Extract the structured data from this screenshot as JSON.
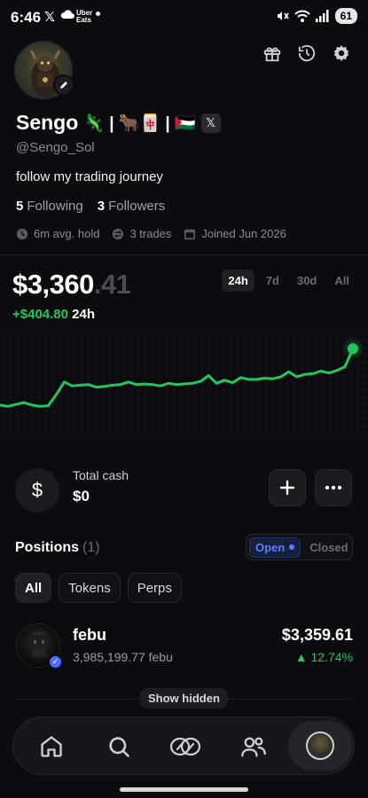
{
  "status_bar": {
    "time": "6:46",
    "x_glyph": "𝕏",
    "uber_line1": "Uber",
    "uber_line2": "Eats",
    "battery": "61",
    "icons": [
      "x-icon",
      "cloud-icon",
      "uber-eats-icon",
      "dot-icon",
      "mute-icon",
      "wifi-icon",
      "signal-icon",
      "battery-icon"
    ]
  },
  "header": {
    "icons": [
      "gift-icon",
      "history-icon",
      "settings-icon"
    ]
  },
  "profile": {
    "name": "Sengo",
    "name_emojis": "🦎 | 🐂🀄 | 🇵🇸",
    "x_badge": "𝕏",
    "handle": "@Sengo_Sol",
    "bio": "follow my trading journey",
    "following_count": "5",
    "following_label": "Following",
    "followers_count": "3",
    "followers_label": "Followers",
    "avg_hold": "6m avg. hold",
    "trades": "3 trades",
    "joined": "Joined Jun 2026"
  },
  "balance": {
    "dollars": "$3,360",
    "cents": ".41",
    "change_amount": "+$404.80",
    "change_period": "24h"
  },
  "range_tabs": [
    "24h",
    "7d",
    "30d",
    "All"
  ],
  "active_range": "24h",
  "chart_data": {
    "type": "line",
    "color": "#22c55e",
    "values": [
      3.2,
      3.0,
      3.3,
      3.6,
      3.2,
      3.0,
      3.1,
      4.8,
      6.8,
      6.2,
      6.3,
      6.4,
      6.0,
      6.1,
      6.3,
      6.4,
      6.8,
      6.4,
      6.5,
      6.4,
      6.2,
      6.6,
      6.4,
      6.5,
      6.6,
      6.9,
      7.8,
      6.6,
      7.1,
      6.7,
      7.5,
      7.2,
      7.2,
      7.4,
      7.3,
      7.6,
      8.4,
      7.6,
      8.0,
      8.1,
      8.5,
      8.2,
      8.6,
      9.2,
      12.0
    ],
    "ylim": [
      0,
      13
    ]
  },
  "cash": {
    "label": "Total cash",
    "value": "$0",
    "icon": "$",
    "add_icon": "+",
    "more_icon": "⋯"
  },
  "positions": {
    "title": "Positions",
    "count": "(1)",
    "toggle_open": "Open",
    "toggle_closed": "Closed",
    "filters": [
      "All",
      "Tokens",
      "Perps"
    ],
    "active_filter": "All",
    "items": [
      {
        "name": "febu",
        "amount": "3,985,199.77 febu",
        "value": "$3,359.61",
        "change": "▲ 12.74%",
        "verified_icon": "✓"
      }
    ],
    "show_hidden": "Show hidden"
  },
  "bottom_nav": [
    "home-icon",
    "search-icon",
    "trade-icon",
    "friends-icon",
    "profile-avatar"
  ]
}
